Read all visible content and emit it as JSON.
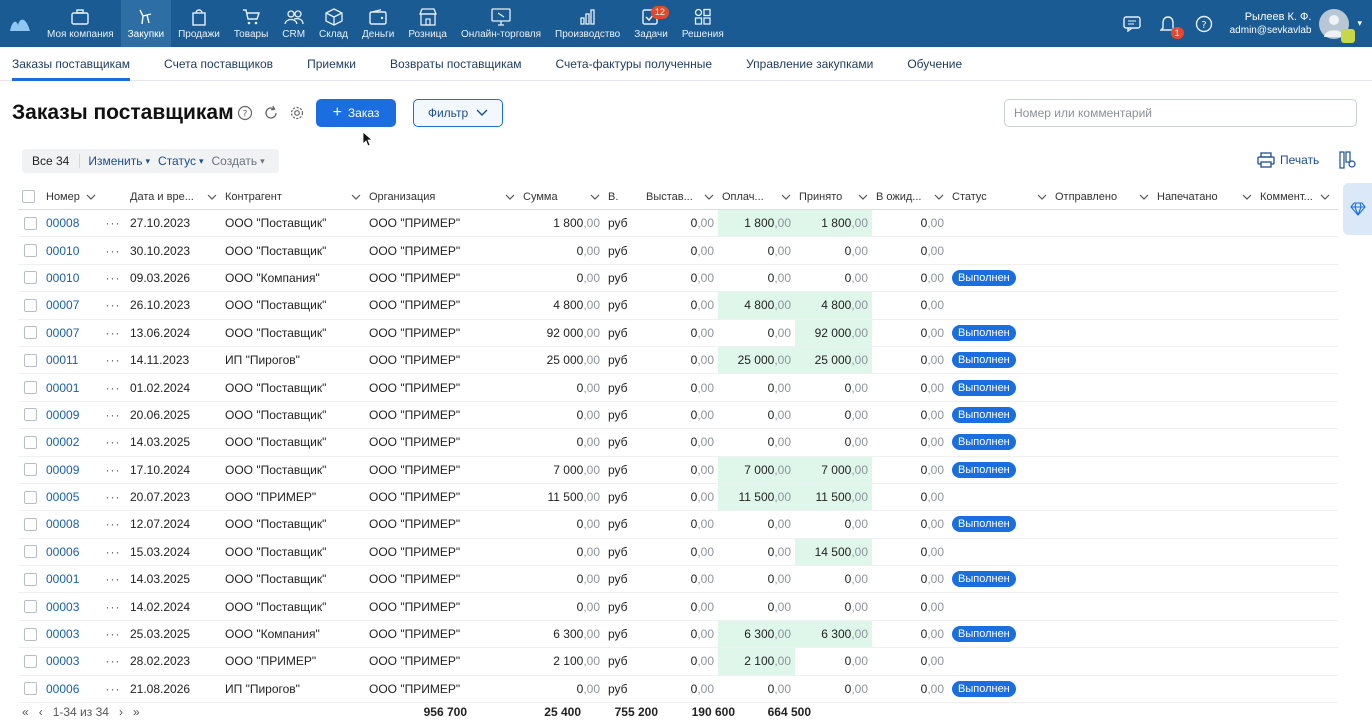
{
  "nav": {
    "items": [
      {
        "label": "Моя компания",
        "icon": "briefcase-icon",
        "active": false
      },
      {
        "label": "Закупки",
        "icon": "purchase-icon",
        "active": true
      },
      {
        "label": "Продажи",
        "icon": "bag-icon",
        "active": false
      },
      {
        "label": "Товары",
        "icon": "cart-icon",
        "active": false
      },
      {
        "label": "CRM",
        "icon": "people-icon",
        "active": false
      },
      {
        "label": "Склад",
        "icon": "box-icon",
        "active": false
      },
      {
        "label": "Деньги",
        "icon": "wallet-icon",
        "active": false
      },
      {
        "label": "Розница",
        "icon": "store-icon",
        "active": false
      },
      {
        "label": "Онлайн-торговля",
        "icon": "online-store-icon",
        "active": false
      },
      {
        "label": "Производство",
        "icon": "chart-icon",
        "active": false
      },
      {
        "label": "Задачи",
        "icon": "task-icon",
        "active": false,
        "badge": "12"
      },
      {
        "label": "Решения",
        "icon": "grid-icon",
        "active": false
      }
    ],
    "notifications_badge": "1",
    "user_name": "Рылеев К. Ф.",
    "user_email": "admin@sevkavlab"
  },
  "subtabs": [
    "Заказы поставщикам",
    "Счета поставщиков",
    "Приемки",
    "Возвраты поставщикам",
    "Счета-фактуры полученные",
    "Управление закупками",
    "Обучение"
  ],
  "page": {
    "title": "Заказы поставщикам",
    "add_button": "Заказ",
    "filter_button": "Фильтр",
    "search_placeholder": "Номер или комментарий",
    "print_label": "Печать"
  },
  "toolbar": {
    "all": "Все 34",
    "edit": "Изменить",
    "status": "Статус",
    "create": "Создать"
  },
  "columns": [
    "Номер",
    "Дата и вре...",
    "Контрагент",
    "Организация",
    "Сумма",
    "В.",
    "Выстав...",
    "Оплач...",
    "Принято",
    "В ожид...",
    "Статус",
    "Отправлено",
    "Напечатано",
    "Коммент..."
  ],
  "rows": [
    {
      "num": "00008",
      "date": "27.10.2023",
      "contr": "ООО \"Поставщик\"",
      "org": "ООО \"ПРИМЕР\"",
      "sum": [
        "1 800",
        ",00"
      ],
      "cur": "руб",
      "vyst": [
        "0",
        ",00"
      ],
      "opl": [
        "1 800",
        ",00"
      ],
      "prin": [
        "1 800",
        ",00"
      ],
      "ozh": [
        "0",
        ",00"
      ],
      "status": "",
      "hl_opl": true,
      "hl_prin": true
    },
    {
      "num": "00010",
      "date": "30.10.2023",
      "contr": "ООО \"Поставщик\"",
      "org": "ООО \"ПРИМЕР\"",
      "sum": [
        "0",
        ",00"
      ],
      "cur": "руб",
      "vyst": [
        "0",
        ",00"
      ],
      "opl": [
        "0",
        ",00"
      ],
      "prin": [
        "0",
        ",00"
      ],
      "ozh": [
        "0",
        ",00"
      ],
      "status": "",
      "hl_opl": false,
      "hl_prin": false
    },
    {
      "num": "00010",
      "date": "09.03.2026",
      "contr": "ООО \"Компания\"",
      "org": "ООО \"ПРИМЕР\"",
      "sum": [
        "0",
        ",00"
      ],
      "cur": "руб",
      "vyst": [
        "0",
        ",00"
      ],
      "opl": [
        "0",
        ",00"
      ],
      "prin": [
        "0",
        ",00"
      ],
      "ozh": [
        "0",
        ",00"
      ],
      "status": "Выполнен",
      "hl_opl": false,
      "hl_prin": false
    },
    {
      "num": "00007",
      "date": "26.10.2023",
      "contr": "ООО \"Поставщик\"",
      "org": "ООО \"ПРИМЕР\"",
      "sum": [
        "4 800",
        ",00"
      ],
      "cur": "руб",
      "vyst": [
        "0",
        ",00"
      ],
      "opl": [
        "4 800",
        ",00"
      ],
      "prin": [
        "4 800",
        ",00"
      ],
      "ozh": [
        "0",
        ",00"
      ],
      "status": "",
      "hl_opl": true,
      "hl_prin": true
    },
    {
      "num": "00007",
      "date": "13.06.2024",
      "contr": "ООО \"Поставщик\"",
      "org": "ООО \"ПРИМЕР\"",
      "sum": [
        "92 000",
        ",00"
      ],
      "cur": "руб",
      "vyst": [
        "0",
        ",00"
      ],
      "opl": [
        "0",
        ",00"
      ],
      "prin": [
        "92 000",
        ",00"
      ],
      "ozh": [
        "0",
        ",00"
      ],
      "status": "Выполнен",
      "hl_opl": false,
      "hl_prin": true
    },
    {
      "num": "00011",
      "date": "14.11.2023",
      "contr": "ИП \"Пирогов\"",
      "org": "ООО \"ПРИМЕР\"",
      "sum": [
        "25 000",
        ",00"
      ],
      "cur": "руб",
      "vyst": [
        "0",
        ",00"
      ],
      "opl": [
        "25 000",
        ",00"
      ],
      "prin": [
        "25 000",
        ",00"
      ],
      "ozh": [
        "0",
        ",00"
      ],
      "status": "Выполнен",
      "hl_opl": true,
      "hl_prin": true
    },
    {
      "num": "00001",
      "date": "01.02.2024",
      "contr": "ООО \"Поставщик\"",
      "org": "ООО \"ПРИМЕР\"",
      "sum": [
        "0",
        ",00"
      ],
      "cur": "руб",
      "vyst": [
        "0",
        ",00"
      ],
      "opl": [
        "0",
        ",00"
      ],
      "prin": [
        "0",
        ",00"
      ],
      "ozh": [
        "0",
        ",00"
      ],
      "status": "Выполнен",
      "hl_opl": false,
      "hl_prin": false
    },
    {
      "num": "00009",
      "date": "20.06.2025",
      "contr": "ООО \"Поставщик\"",
      "org": "ООО \"ПРИМЕР\"",
      "sum": [
        "0",
        ",00"
      ],
      "cur": "руб",
      "vyst": [
        "0",
        ",00"
      ],
      "opl": [
        "0",
        ",00"
      ],
      "prin": [
        "0",
        ",00"
      ],
      "ozh": [
        "0",
        ",00"
      ],
      "status": "Выполнен",
      "hl_opl": false,
      "hl_prin": false
    },
    {
      "num": "00002",
      "date": "14.03.2025",
      "contr": "ООО \"Поставщик\"",
      "org": "ООО \"ПРИМЕР\"",
      "sum": [
        "0",
        ",00"
      ],
      "cur": "руб",
      "vyst": [
        "0",
        ",00"
      ],
      "opl": [
        "0",
        ",00"
      ],
      "prin": [
        "0",
        ",00"
      ],
      "ozh": [
        "0",
        ",00"
      ],
      "status": "Выполнен",
      "hl_opl": false,
      "hl_prin": false
    },
    {
      "num": "00009",
      "date": "17.10.2024",
      "contr": "ООО \"Поставщик\"",
      "org": "ООО \"ПРИМЕР\"",
      "sum": [
        "7 000",
        ",00"
      ],
      "cur": "руб",
      "vyst": [
        "0",
        ",00"
      ],
      "opl": [
        "7 000",
        ",00"
      ],
      "prin": [
        "7 000",
        ",00"
      ],
      "ozh": [
        "0",
        ",00"
      ],
      "status": "Выполнен",
      "hl_opl": true,
      "hl_prin": true
    },
    {
      "num": "00005",
      "date": "20.07.2023",
      "contr": "ООО \"ПРИМЕР\"",
      "org": "ООО \"ПРИМЕР\"",
      "sum": [
        "11 500",
        ",00"
      ],
      "cur": "руб",
      "vyst": [
        "0",
        ",00"
      ],
      "opl": [
        "11 500",
        ",00"
      ],
      "prin": [
        "11 500",
        ",00"
      ],
      "ozh": [
        "0",
        ",00"
      ],
      "status": "",
      "hl_opl": true,
      "hl_prin": true
    },
    {
      "num": "00008",
      "date": "12.07.2024",
      "contr": "ООО \"Поставщик\"",
      "org": "ООО \"ПРИМЕР\"",
      "sum": [
        "0",
        ",00"
      ],
      "cur": "руб",
      "vyst": [
        "0",
        ",00"
      ],
      "opl": [
        "0",
        ",00"
      ],
      "prin": [
        "0",
        ",00"
      ],
      "ozh": [
        "0",
        ",00"
      ],
      "status": "Выполнен",
      "hl_opl": false,
      "hl_prin": false
    },
    {
      "num": "00006",
      "date": "15.03.2024",
      "contr": "ООО \"Поставщик\"",
      "org": "ООО \"ПРИМЕР\"",
      "sum": [
        "0",
        ",00"
      ],
      "cur": "руб",
      "vyst": [
        "0",
        ",00"
      ],
      "opl": [
        "0",
        ",00"
      ],
      "prin": [
        "14 500",
        ",00"
      ],
      "ozh": [
        "0",
        ",00"
      ],
      "status": "",
      "hl_opl": false,
      "hl_prin": true
    },
    {
      "num": "00001",
      "date": "14.03.2025",
      "contr": "ООО \"Поставщик\"",
      "org": "ООО \"ПРИМЕР\"",
      "sum": [
        "0",
        ",00"
      ],
      "cur": "руб",
      "vyst": [
        "0",
        ",00"
      ],
      "opl": [
        "0",
        ",00"
      ],
      "prin": [
        "0",
        ",00"
      ],
      "ozh": [
        "0",
        ",00"
      ],
      "status": "Выполнен",
      "hl_opl": false,
      "hl_prin": false
    },
    {
      "num": "00003",
      "date": "14.02.2024",
      "contr": "ООО \"Поставщик\"",
      "org": "ООО \"ПРИМЕР\"",
      "sum": [
        "0",
        ",00"
      ],
      "cur": "руб",
      "vyst": [
        "0",
        ",00"
      ],
      "opl": [
        "0",
        ",00"
      ],
      "prin": [
        "0",
        ",00"
      ],
      "ozh": [
        "0",
        ",00"
      ],
      "status": "",
      "hl_opl": false,
      "hl_prin": false
    },
    {
      "num": "00003",
      "date": "25.03.2025",
      "contr": "ООО \"Компания\"",
      "org": "ООО \"ПРИМЕР\"",
      "sum": [
        "6 300",
        ",00"
      ],
      "cur": "руб",
      "vyst": [
        "0",
        ",00"
      ],
      "opl": [
        "6 300",
        ",00"
      ],
      "prin": [
        "6 300",
        ",00"
      ],
      "ozh": [
        "0",
        ",00"
      ],
      "status": "Выполнен",
      "hl_opl": true,
      "hl_prin": true
    },
    {
      "num": "00003",
      "date": "28.02.2023",
      "contr": "ООО \"ПРИМЕР\"",
      "org": "ООО \"ПРИМЕР\"",
      "sum": [
        "2 100",
        ",00"
      ],
      "cur": "руб",
      "vyst": [
        "0",
        ",00"
      ],
      "opl": [
        "2 100",
        ",00"
      ],
      "prin": [
        "0",
        ",00"
      ],
      "ozh": [
        "0",
        ",00"
      ],
      "status": "",
      "hl_opl": true,
      "hl_prin": false
    },
    {
      "num": "00006",
      "date": "21.08.2026",
      "contr": "ИП \"Пирогов\"",
      "org": "ООО \"ПРИМЕР\"",
      "sum": [
        "0",
        ",00"
      ],
      "cur": "руб",
      "vyst": [
        "0",
        ",00"
      ],
      "opl": [
        "0",
        ",00"
      ],
      "prin": [
        "0",
        ",00"
      ],
      "ozh": [
        "0",
        ",00"
      ],
      "status": "Выполнен",
      "hl_opl": false,
      "hl_prin": false
    }
  ],
  "footer": {
    "pager": "1-34 из 34",
    "total_sum": "956 700",
    "total_vyst": "25 400",
    "total_opl": "755 200",
    "total_prin": "190 600",
    "total_ozh": "664 500"
  },
  "colors": {
    "nav_bg": "#1a5b94",
    "accent": "#1a6ee0",
    "highlight": "#def7ea",
    "badge": "#e5482e"
  }
}
